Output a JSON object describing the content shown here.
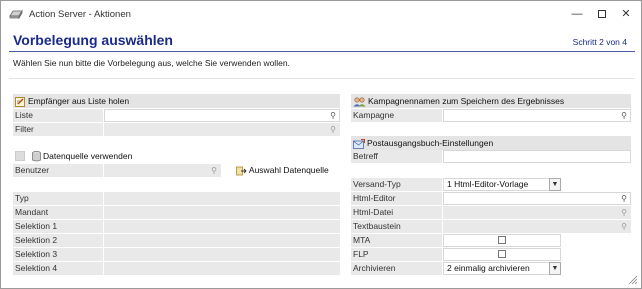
{
  "window": {
    "title": "Action Server - Aktionen"
  },
  "header": {
    "title": "Vorbelegung auswählen",
    "step": "Schritt 2 von 4"
  },
  "intro": "Wählen Sie nun bitte die Vorbelegung aus, welche Sie verwenden wollen.",
  "left": {
    "section_title": "Empfänger aus Liste holen",
    "liste_label": "Liste",
    "filter_label": "Filter",
    "datasource_label": "Datenquelle verwenden",
    "benutzer_label": "Benutzer",
    "auswahl_label": "Auswahl Datenquelle",
    "rows": [
      "Typ",
      "Mandant",
      "Selektion 1",
      "Selektion 2",
      "Selektion 3",
      "Selektion 4"
    ]
  },
  "right": {
    "campaign_section_title": "Kampagnennamen zum Speichern des Ergebnisses",
    "kampagne_label": "Kampagne",
    "postout_section_title": "Postausgangsbuch-Einstellungen",
    "betreff_label": "Betreff",
    "versand_label": "Versand-Typ",
    "versand_value": "1 Html-Editor-Vorlage",
    "html_editor_label": "Html-Editor",
    "html_datei_label": "Html-Datei",
    "textbaustein_label": "Textbaustein",
    "mta_label": "MTA",
    "flp_label": "FLP",
    "archivieren_label": "Archivieren",
    "archivieren_value": "2 einmalig archivieren"
  },
  "icons": {
    "app": "server-icon",
    "minimize": "minimize-icon",
    "maximize": "maximize-icon",
    "close": "close-icon"
  }
}
